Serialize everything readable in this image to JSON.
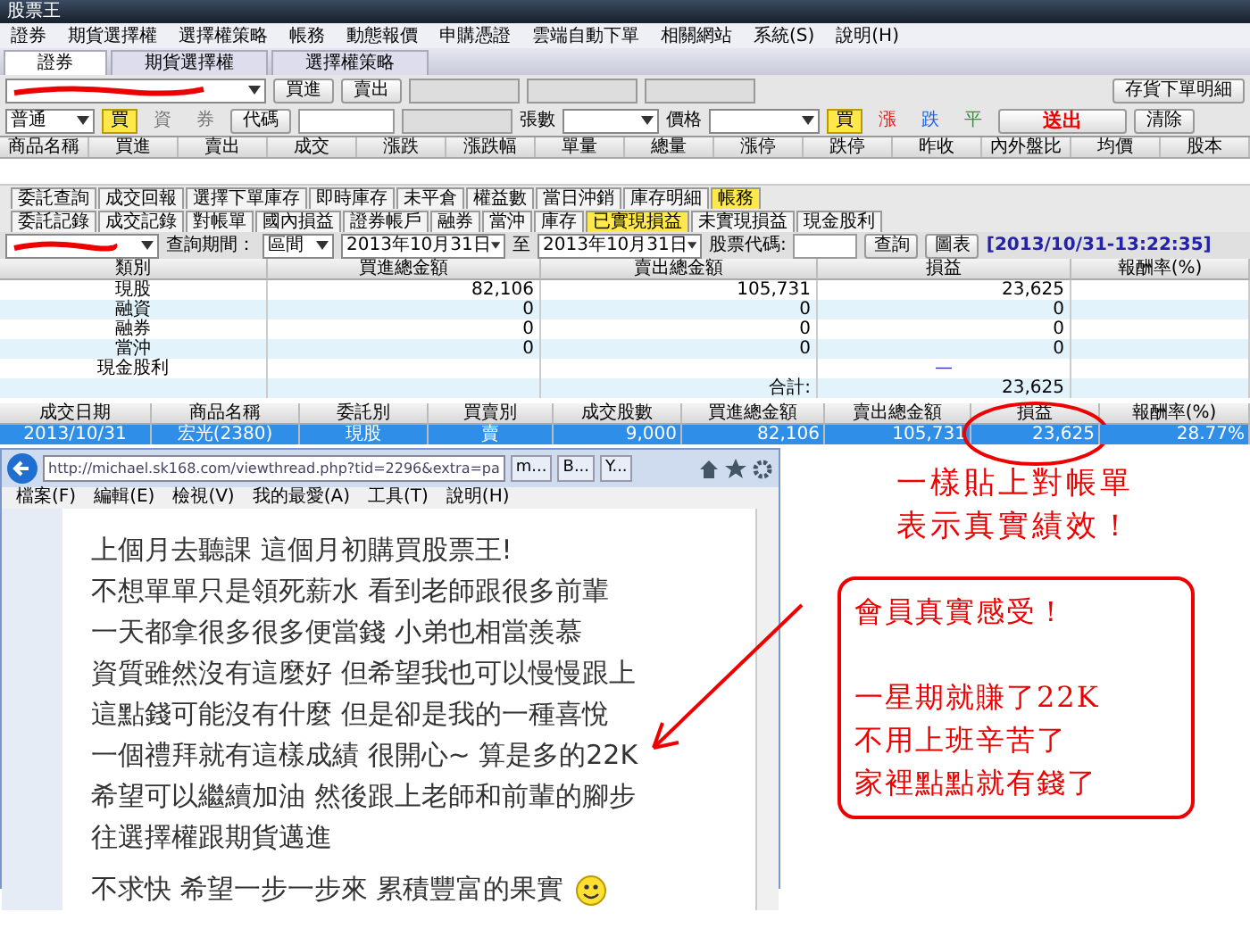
{
  "window": {
    "title": "股票王"
  },
  "menu": [
    "證券",
    "期貨選擇權",
    "選擇權策略",
    "帳務",
    "動態報價",
    "申購憑證",
    "雲端自動下單",
    "相關網站",
    "系統(S)",
    "說明(H)"
  ],
  "main_tabs": [
    {
      "label": "證券",
      "selected": true
    },
    {
      "label": "期貨選擇權",
      "selected": false
    },
    {
      "label": "選擇權策略",
      "selected": false
    }
  ],
  "order_bar": {
    "buttons": [
      "買進",
      "賣出"
    ],
    "detail_button": "存貨下單明細",
    "order_type": "普通",
    "side_options": [
      {
        "label": "買",
        "selected": true
      },
      {
        "label": "資",
        "selected": false
      },
      {
        "label": "券",
        "selected": false
      }
    ],
    "code_button": "代碼",
    "qty_label": "張數",
    "price_label": "價格",
    "price_flags": [
      {
        "label": "買",
        "selected": true
      },
      {
        "label": "漲",
        "selected": false,
        "color": "#e02020"
      },
      {
        "label": "跌",
        "selected": false,
        "color": "#2060e0"
      },
      {
        "label": "平",
        "selected": false,
        "color": "#20a020"
      }
    ],
    "send_button": "送出",
    "clear_button": "清除"
  },
  "quote_columns": [
    "商品名稱",
    "買進",
    "賣出",
    "成交",
    "漲跌",
    "漲跌幅",
    "單量",
    "總量",
    "漲停",
    "跌停",
    "昨收",
    "內外盤比",
    "均價",
    "股本"
  ],
  "lower_tabs": [
    {
      "tabs": [
        {
          "label": "委託查詢",
          "selected": false
        },
        {
          "label": "成交回報",
          "selected": false
        },
        {
          "label": "選擇下單庫存",
          "selected": false
        },
        {
          "label": "即時庫存",
          "selected": false
        },
        {
          "label": "未平倉",
          "selected": false
        },
        {
          "label": "權益數",
          "selected": false
        },
        {
          "label": "當日沖銷",
          "selected": false
        },
        {
          "label": "庫存明細",
          "selected": false
        },
        {
          "label": "帳務",
          "selected": true
        }
      ]
    },
    {
      "tabs": [
        {
          "label": "委託記錄",
          "selected": false
        },
        {
          "label": "成交記錄",
          "selected": false
        },
        {
          "label": "對帳單",
          "selected": false
        },
        {
          "label": "國內損益",
          "selected": false
        },
        {
          "label": "證券帳戶",
          "selected": false
        },
        {
          "label": "融券",
          "selected": false
        },
        {
          "label": "當沖",
          "selected": false
        },
        {
          "label": "庫存",
          "selected": false
        },
        {
          "label": "已實現損益",
          "selected": true
        },
        {
          "label": "未實現損益",
          "selected": false
        },
        {
          "label": "現金股利",
          "selected": false
        }
      ]
    }
  ],
  "query": {
    "period_label": "查詢期間：",
    "period": "區間",
    "start_date": "2013年10月31日",
    "to": "至",
    "end_date": "2013年10月31日",
    "code_label": "股票代碼:",
    "buttons": [
      "查詢",
      "圖表"
    ],
    "timestamp": "[2013/10/31-13:22:35]"
  },
  "summary": {
    "columns": [
      "類別",
      "買進總金額",
      "賣出總金額",
      "損益",
      "報酬率(%)"
    ],
    "rows": [
      {
        "category": "現股",
        "buy_total": "82,106",
        "sell_total": "105,731",
        "pnl": "23,625"
      },
      {
        "category": "融資",
        "buy_total": "0",
        "sell_total": "0",
        "pnl": "0"
      },
      {
        "category": "融券",
        "buy_total": "0",
        "sell_total": "0",
        "pnl": "0"
      },
      {
        "category": "當沖",
        "buy_total": "0",
        "sell_total": "0",
        "pnl": "0"
      },
      {
        "category": "現金股利",
        "pnl": "—"
      },
      {
        "sell_total": "合計:",
        "pnl": "23,625"
      }
    ]
  },
  "detail": {
    "columns": [
      "成交日期",
      "商品名稱",
      "委託別",
      "買賣別",
      "成交股數",
      "買進總金額",
      "賣出總金額",
      "損益",
      "報酬率(%)"
    ],
    "rows": [
      {
        "selected": true,
        "cells": [
          "2013/10/31",
          "宏光(2380)",
          "現股",
          "賣",
          "9,000",
          "82,106",
          "105,731",
          "23,625",
          "28.77%"
        ]
      }
    ]
  },
  "browser": {
    "url": "http://michael.sk168.com/viewthread.php?tid=2296&extra=pa",
    "tabs": [
      "m...",
      "B...",
      "Y..."
    ],
    "menu": [
      "檔案(F)",
      "編輯(E)",
      "檢視(V)",
      "我的最愛(A)",
      "工具(T)",
      "說明(H)"
    ],
    "post_lines": [
      "上個月去聽課 這個月初購買股票王!",
      "不想單單只是領死薪水 看到老師跟很多前輩",
      "一天都拿很多很多便當錢 小弟也相當羨慕",
      "資質雖然沒有這麼好 但希望我也可以慢慢跟上",
      "這點錢可能沒有什麼 但是卻是我的一種喜悅",
      "一個禮拜就有這樣成績 很開心~ 算是多的22K",
      "希望可以繼續加油 然後跟上老師和前輩的腳步",
      "往選擇權跟期貨邁進",
      "不求快 希望一步一步來 累積豐富的果實"
    ]
  },
  "annotations": {
    "caption_lines": [
      "一樣貼上對帳單",
      "表示真實績效！"
    ],
    "box_title": "會員真實感受！",
    "box_lines": [
      "一星期就賺了22K",
      "不用上班辛苦了",
      "家裡點點就有錢了"
    ]
  }
}
